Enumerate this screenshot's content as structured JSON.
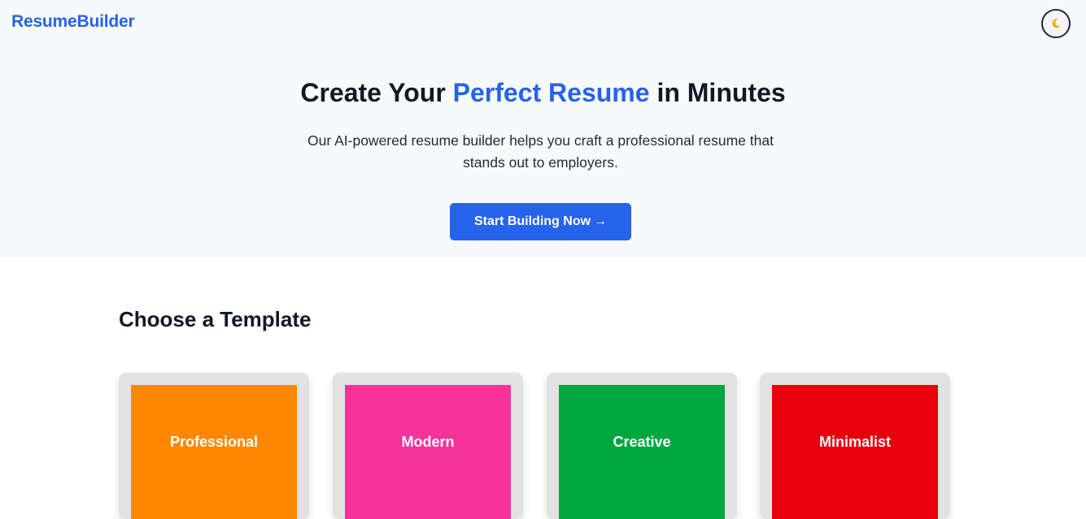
{
  "header": {
    "logo": "ResumeBuilder",
    "theme_toggle_icon": "moon-icon"
  },
  "hero": {
    "title_before": "Create Your ",
    "title_accent": "Perfect Resume",
    "title_after": " in Minutes",
    "subtitle": "Our AI-powered resume builder helps you craft a professional resume that stands out to employers.",
    "cta_label": "Start Building Now",
    "cta_arrow": "→"
  },
  "templates": {
    "heading": "Choose a Template",
    "items": [
      {
        "label": "Professional",
        "color": "#ff8800"
      },
      {
        "label": "Modern",
        "color": "#f6339a"
      },
      {
        "label": "Creative",
        "color": "#00a63e"
      },
      {
        "label": "Minimalist",
        "color": "#e7000b"
      }
    ]
  },
  "colors": {
    "brand": "#2563eb",
    "hero_bg": "#f8f9fb",
    "moon": "#f0b100"
  }
}
